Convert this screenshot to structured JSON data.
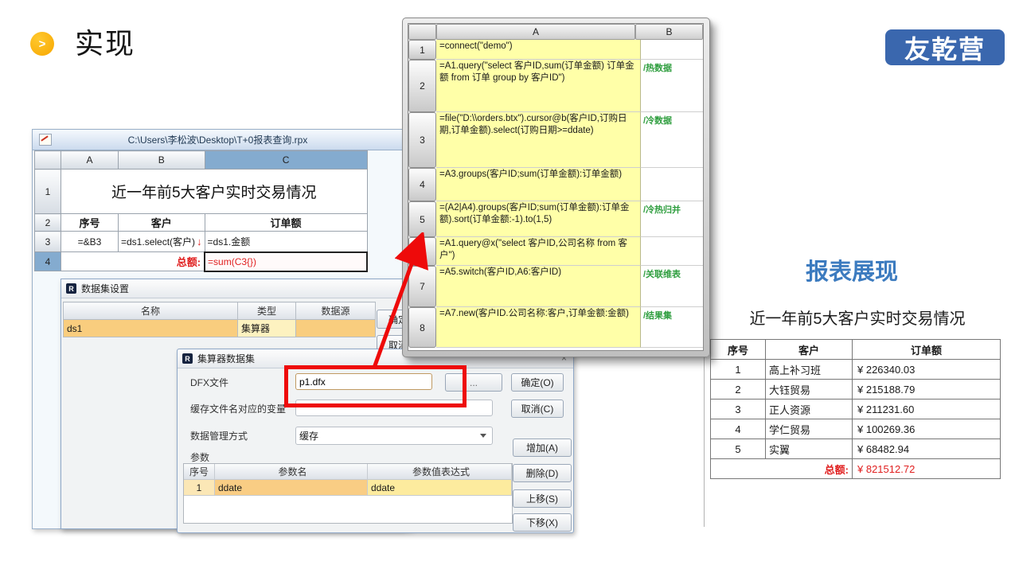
{
  "slide": {
    "title": "实现",
    "logo_text": "友乾营"
  },
  "icons": {
    "bullet_chevron": ">",
    "close_x": "×",
    "red_down_arrow": "↓",
    "browse_dots": "...",
    "esproc_logo": "R"
  },
  "designer": {
    "title_path": "C:\\Users\\李松波\\Desktop\\T+0报表查询.rpx",
    "col_headers": [
      "A",
      "B",
      "C"
    ],
    "rows_numbers": [
      "1",
      "2",
      "3",
      "4"
    ],
    "report_title": "近一年前5大客户实时交易情况",
    "header_row": [
      "序号",
      "客户",
      "订单额"
    ],
    "formula_row": [
      "=&B3",
      "=ds1.select(客户)",
      "=ds1.金额"
    ],
    "total_row": {
      "label": "总额:",
      "formula": "=sum(C3{})"
    }
  },
  "code_panel": {
    "col_headers": [
      "A",
      "B"
    ],
    "rows": [
      {
        "n": "1",
        "a": "=connect(\"demo\")",
        "b": ""
      },
      {
        "n": "2",
        "a": "=A1.query(\"select 客户ID,sum(订单金额) 订单金额 from 订单 group by 客户ID\")",
        "b": "/热数据"
      },
      {
        "n": "3",
        "a": "=file(\"D:\\\\orders.btx\").cursor@b(客户ID,订购日期,订单金额).select(订购日期>=ddate)",
        "b": "/冷数据"
      },
      {
        "n": "4",
        "a": "=A3.groups(客户ID;sum(订单金额):订单金额)",
        "b": ""
      },
      {
        "n": "5",
        "a": "=(A2|A4).groups(客户ID;sum(订单金额):订单金额).sort(订单金额:-1).to(1,5)",
        "b": "/冷热归并"
      },
      {
        "n": "6",
        "a": "=A1.query@x(\"select 客户ID,公司名称 from 客户\")",
        "b": ""
      },
      {
        "n": "7",
        "a": "=A5.switch(客户ID,A6:客户ID)",
        "b": "/关联维表"
      },
      {
        "n": "8",
        "a": "=A7.new(客户ID.公司名称:客户,订单金额:金额)",
        "b": "/结果集"
      }
    ]
  },
  "dataset_dialog": {
    "title": "数据集设置",
    "table_headers": [
      "名称",
      "类型",
      "数据源"
    ],
    "row": [
      "ds1",
      "集算器",
      ""
    ],
    "ok_label": "确定",
    "cancel_label": "取消"
  },
  "esproc_dialog": {
    "title": "集算器数据集",
    "dfx_label": "DFX文件",
    "dfx_value": "p1.dfx",
    "cache_label": "缓存文件名对应的变量",
    "cache_value": "",
    "mgmt_label": "数据管理方式",
    "mgmt_value": "缓存",
    "param_label": "参数",
    "param_headers": [
      "序号",
      "参数名",
      "参数值表达式"
    ],
    "param_row": [
      "1",
      "ddate",
      "ddate"
    ],
    "ok_label": "确定(O)",
    "cancel_label": "取消(C)",
    "side_buttons": [
      "增加(A)",
      "删除(D)",
      "上移(S)",
      "下移(X)"
    ]
  },
  "report": {
    "heading": "报表展现",
    "title": "近一年前5大客户实时交易情况",
    "headers": [
      "序号",
      "客户",
      "订单额"
    ],
    "rows": [
      [
        "1",
        "高上补习班",
        "¥ 226340.03"
      ],
      [
        "2",
        "大钰贸易",
        "¥ 215188.79"
      ],
      [
        "3",
        "正人资源",
        "¥ 211231.60"
      ],
      [
        "4",
        "学仁贸易",
        "¥ 100269.36"
      ],
      [
        "5",
        "实翼",
        "¥ 68482.94"
      ]
    ],
    "total_label": "总额:",
    "total_value": "¥ 821512.72"
  },
  "colors": {
    "accent_red": "#ee0a0a",
    "total_red": "#e02020",
    "logo_blue": "#3a67ae",
    "heading_blue": "#3c7bbf",
    "code_cell_yellow": "#ffffa8",
    "comment_green": "#2f9e3f",
    "selected_header_blue": "#84abcf",
    "dataset_row_orange": "#f9cd7e",
    "dataset_type_yellow": "#fdf2c0"
  }
}
